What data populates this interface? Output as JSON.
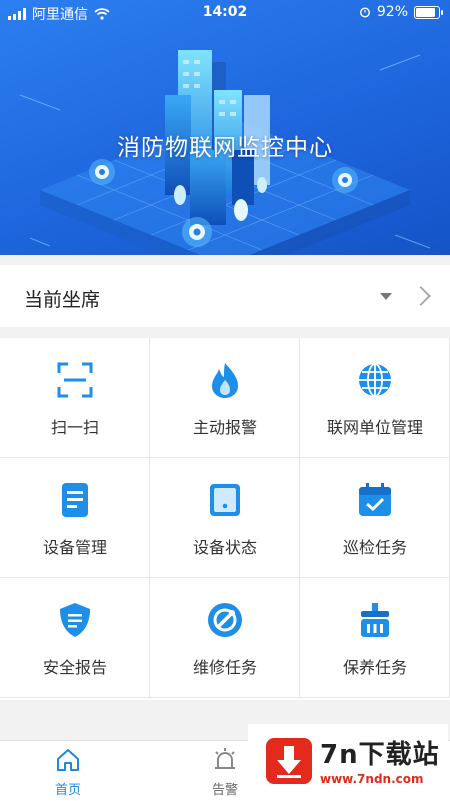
{
  "status_bar": {
    "carrier": "阿里通信",
    "time": "14:02",
    "battery": "92%"
  },
  "banner": {
    "title": "消防物联网监控中心"
  },
  "seat": {
    "label": "当前坐席"
  },
  "menu": [
    {
      "label": "扫一扫",
      "icon": "scan-icon"
    },
    {
      "label": "主动报警",
      "icon": "flame-icon"
    },
    {
      "label": "联网单位管理",
      "icon": "globe-icon"
    },
    {
      "label": "设备管理",
      "icon": "document-icon"
    },
    {
      "label": "设备状态",
      "icon": "tablet-icon"
    },
    {
      "label": "巡检任务",
      "icon": "calendar-check-icon"
    },
    {
      "label": "安全报告",
      "icon": "shield-report-icon"
    },
    {
      "label": "维修任务",
      "icon": "repair-icon"
    },
    {
      "label": "保养任务",
      "icon": "maintenance-icon"
    }
  ],
  "tabs": [
    {
      "label": "首页",
      "icon": "home-icon",
      "active": true
    },
    {
      "label": "告警",
      "icon": "alarm-icon",
      "active": false
    }
  ],
  "watermark": {
    "main": "7n下载站",
    "sub": "www.7ndn.com"
  },
  "colors": {
    "accent": "#1e88e5",
    "banner": "#1e66dd",
    "watermark_red": "#e42a1d"
  }
}
